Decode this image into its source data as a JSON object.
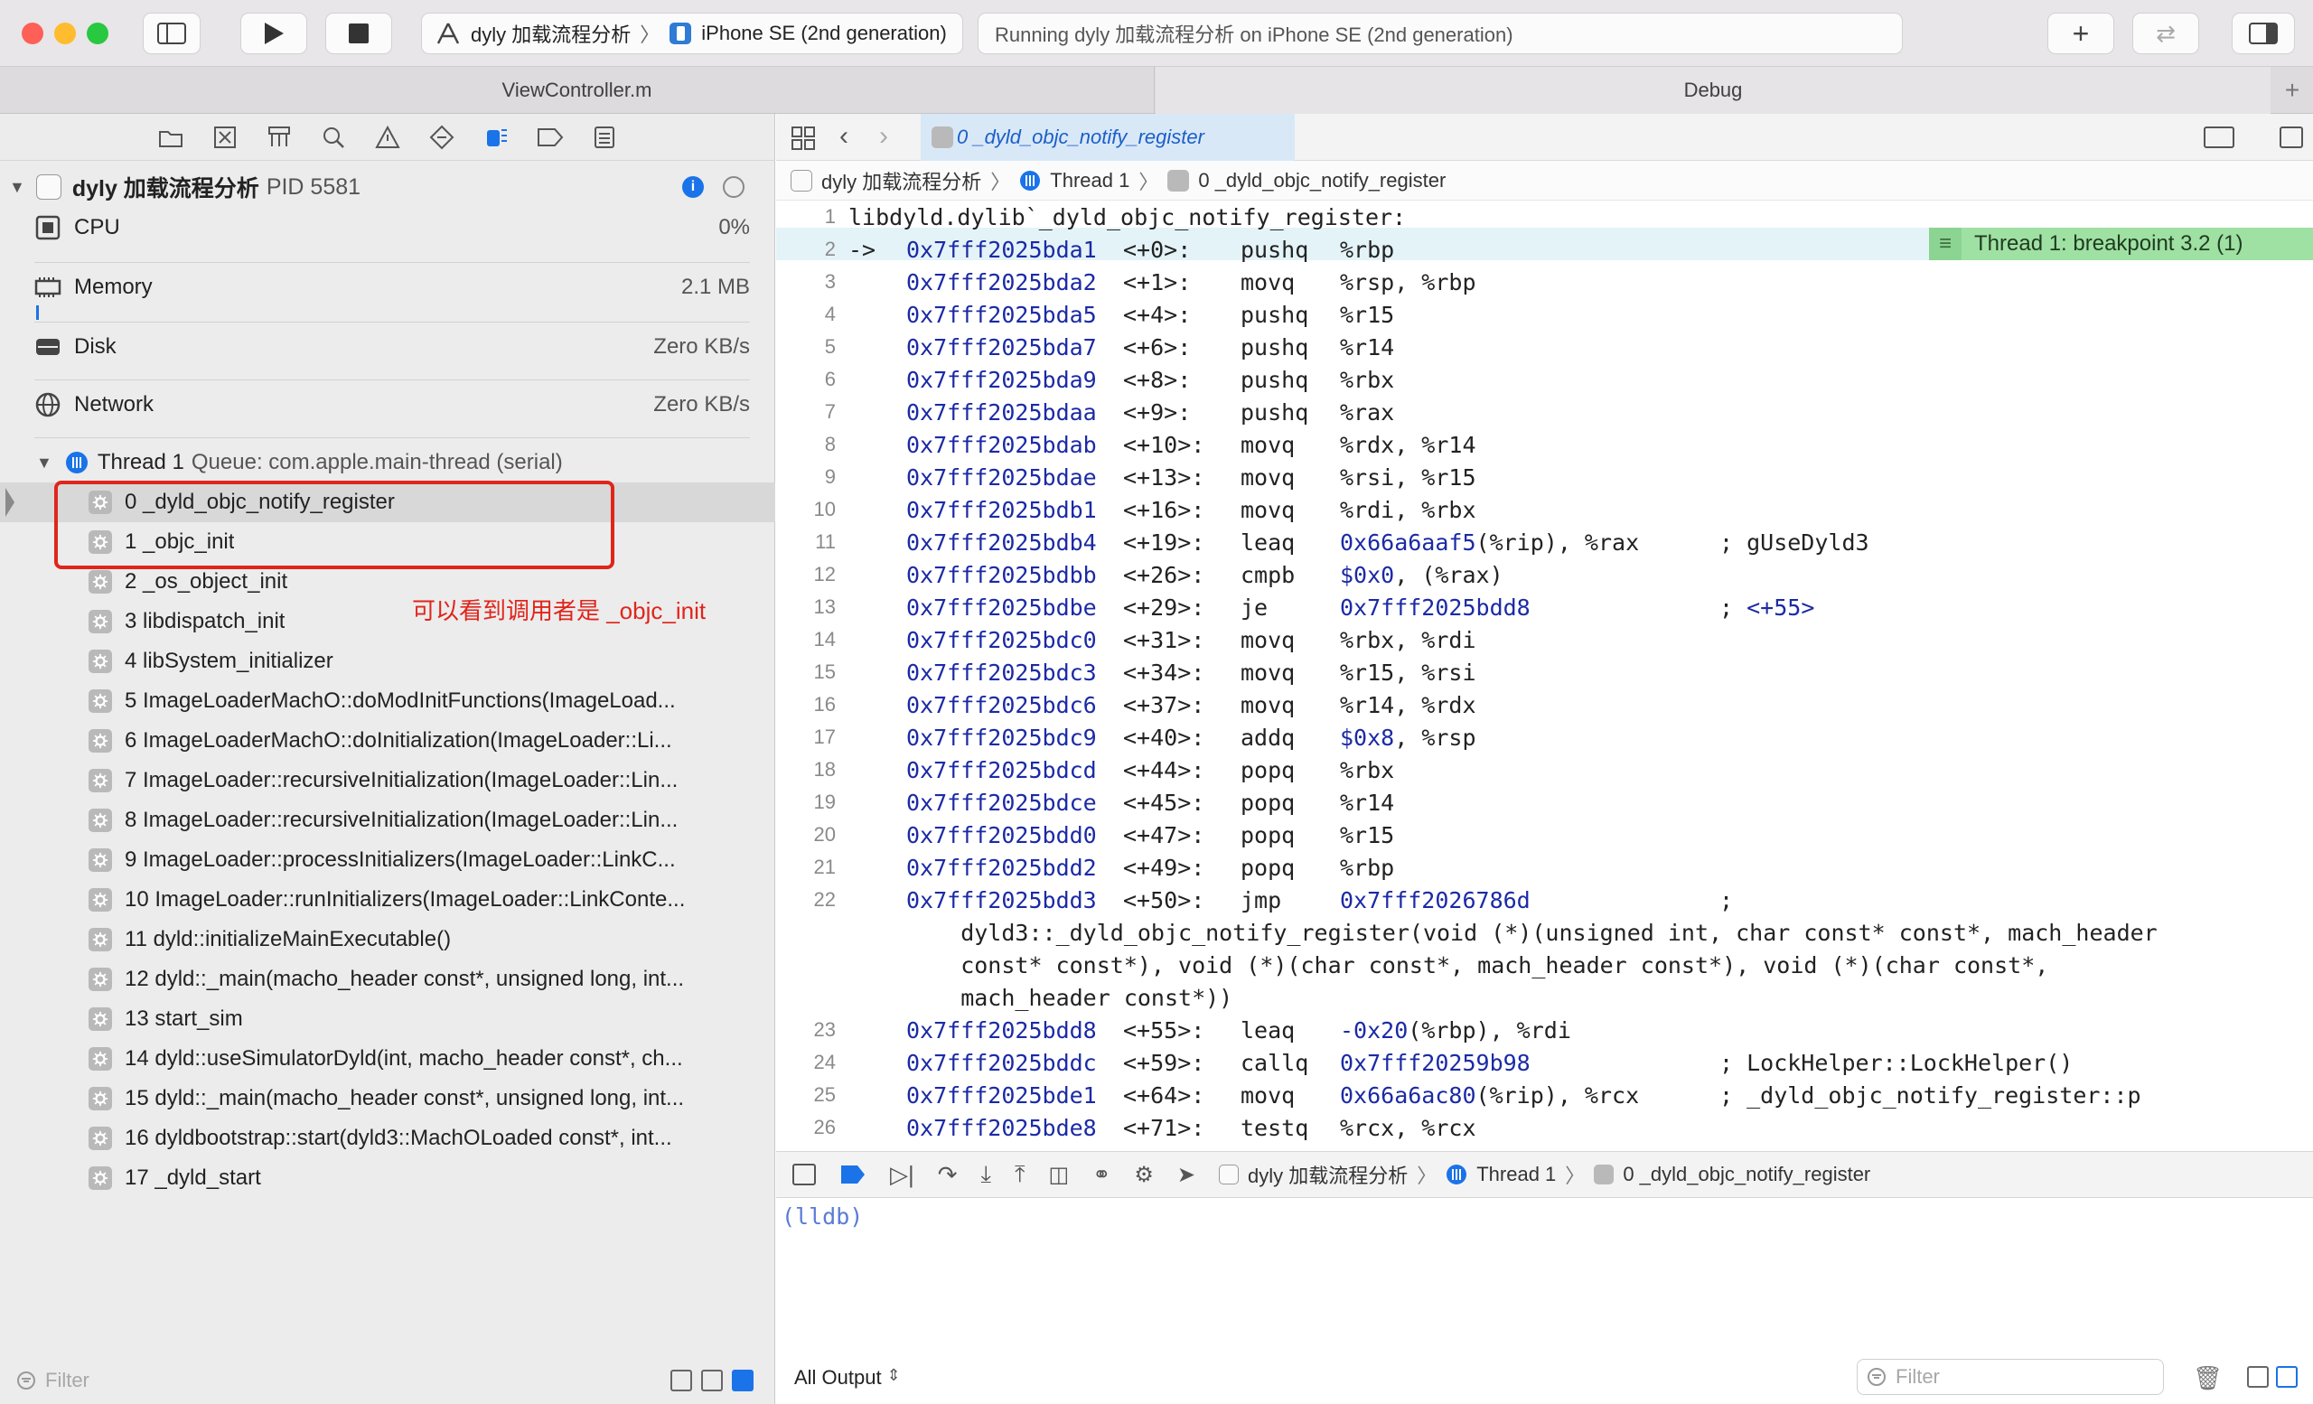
{
  "window": {
    "scheme": "dyly 加载流程分析",
    "device": "iPhone SE (2nd generation)",
    "status": "Running dyly 加载流程分析 on iPhone SE (2nd generation)"
  },
  "tabs": [
    "ViewController.m",
    "Debug"
  ],
  "navigator": {
    "process": {
      "name": "dyly 加载流程分析",
      "pid": "PID 5581"
    },
    "gauges": [
      {
        "label": "CPU",
        "value": "0%"
      },
      {
        "label": "Memory",
        "value": "2.1 MB"
      },
      {
        "label": "Disk",
        "value": "Zero KB/s"
      },
      {
        "label": "Network",
        "value": "Zero KB/s"
      }
    ],
    "thread": {
      "name": "Thread 1",
      "queue": "Queue: com.apple.main-thread (serial)"
    },
    "frames": [
      "0 _dyld_objc_notify_register",
      "1 _objc_init",
      "2 _os_object_init",
      "3 libdispatch_init",
      "4 libSystem_initializer",
      "5 ImageLoaderMachO::doModInitFunctions(ImageLoad...",
      "6 ImageLoaderMachO::doInitialization(ImageLoader::Li...",
      "7 ImageLoader::recursiveInitialization(ImageLoader::Lin...",
      "8 ImageLoader::recursiveInitialization(ImageLoader::Lin...",
      "9 ImageLoader::processInitializers(ImageLoader::LinkC...",
      "10 ImageLoader::runInitializers(ImageLoader::LinkConte...",
      "11 dyld::initializeMainExecutable()",
      "12 dyld::_main(macho_header const*, unsigned long, int...",
      "13 start_sim",
      "14 dyld::useSimulatorDyld(int, macho_header const*, ch...",
      "15 dyld::_main(macho_header const*, unsigned long, int...",
      "16 dyldbootstrap::start(dyld3::MachOLoaded const*, int...",
      "17 _dyld_start"
    ],
    "annotation": "可以看到调用者是 _objc_init",
    "filter_placeholder": "Filter"
  },
  "editor": {
    "tab_title": "0 _dyld_objc_notify_register",
    "crumbs": [
      "dyly 加载流程分析",
      "Thread 1",
      "0 _dyld_objc_notify_register"
    ],
    "breakpoint_label": "Thread 1: breakpoint 3.2 (1)",
    "lines": [
      {
        "n": "1",
        "a": "",
        "o": "",
        "m": "",
        "args": "libdyld.dylib`_dyld_objc_notify_register:",
        "c": ""
      },
      {
        "n": "2",
        "a": "0x7fff2025bda1",
        "o": "<+0>:",
        "m": "pushq",
        "args": "%rbp",
        "c": ""
      },
      {
        "n": "3",
        "a": "0x7fff2025bda2",
        "o": "<+1>:",
        "m": "movq",
        "args": "%rsp, %rbp",
        "c": ""
      },
      {
        "n": "4",
        "a": "0x7fff2025bda5",
        "o": "<+4>:",
        "m": "pushq",
        "args": "%r15",
        "c": ""
      },
      {
        "n": "5",
        "a": "0x7fff2025bda7",
        "o": "<+6>:",
        "m": "pushq",
        "args": "%r14",
        "c": ""
      },
      {
        "n": "6",
        "a": "0x7fff2025bda9",
        "o": "<+8>:",
        "m": "pushq",
        "args": "%rbx",
        "c": ""
      },
      {
        "n": "7",
        "a": "0x7fff2025bdaa",
        "o": "<+9>:",
        "m": "pushq",
        "args": "%rax",
        "c": ""
      },
      {
        "n": "8",
        "a": "0x7fff2025bdab",
        "o": "<+10>:",
        "m": "movq",
        "args": "%rdx, %r14",
        "c": ""
      },
      {
        "n": "9",
        "a": "0x7fff2025bdae",
        "o": "<+13>:",
        "m": "movq",
        "args": "%rsi, %r15",
        "c": ""
      },
      {
        "n": "10",
        "a": "0x7fff2025bdb1",
        "o": "<+16>:",
        "m": "movq",
        "args": "%rdi, %rbx",
        "c": ""
      },
      {
        "n": "11",
        "a": "0x7fff2025bdb4",
        "o": "<+19>:",
        "m": "leaq",
        "args": "0x66a6aaf5(%rip), %rax",
        "c": "; gUseDyld3"
      },
      {
        "n": "12",
        "a": "0x7fff2025bdbb",
        "o": "<+26>:",
        "m": "cmpb",
        "args": "$0x0, (%rax)",
        "c": ""
      },
      {
        "n": "13",
        "a": "0x7fff2025bdbe",
        "o": "<+29>:",
        "m": "je",
        "args": "0x7fff2025bdd8",
        "c": "; <+55>"
      },
      {
        "n": "14",
        "a": "0x7fff2025bdc0",
        "o": "<+31>:",
        "m": "movq",
        "args": "%rbx, %rdi",
        "c": ""
      },
      {
        "n": "15",
        "a": "0x7fff2025bdc3",
        "o": "<+34>:",
        "m": "movq",
        "args": "%r15, %rsi",
        "c": ""
      },
      {
        "n": "16",
        "a": "0x7fff2025bdc6",
        "o": "<+37>:",
        "m": "movq",
        "args": "%r14, %rdx",
        "c": ""
      },
      {
        "n": "17",
        "a": "0x7fff2025bdc9",
        "o": "<+40>:",
        "m": "addq",
        "args": "$0x8, %rsp",
        "c": ""
      },
      {
        "n": "18",
        "a": "0x7fff2025bdcd",
        "o": "<+44>:",
        "m": "popq",
        "args": "%rbx",
        "c": ""
      },
      {
        "n": "19",
        "a": "0x7fff2025bdce",
        "o": "<+45>:",
        "m": "popq",
        "args": "%r14",
        "c": ""
      },
      {
        "n": "20",
        "a": "0x7fff2025bdd0",
        "o": "<+47>:",
        "m": "popq",
        "args": "%r15",
        "c": ""
      },
      {
        "n": "21",
        "a": "0x7fff2025bdd2",
        "o": "<+49>:",
        "m": "popq",
        "args": "%rbp",
        "c": ""
      },
      {
        "n": "22",
        "a": "0x7fff2025bdd3",
        "o": "<+50>:",
        "m": "jmp",
        "args": "0x7fff2026786d",
        "c": ";"
      },
      {
        "n": "",
        "a": "",
        "o": "",
        "m": "",
        "args": "    dyld3::_dyld_objc_notify_register(void (*)(unsigned int, char const* const*, mach_header",
        "c": ""
      },
      {
        "n": "",
        "a": "",
        "o": "",
        "m": "",
        "args": "    const* const*), void (*)(char const*, mach_header const*), void (*)(char const*,",
        "c": ""
      },
      {
        "n": "",
        "a": "",
        "o": "",
        "m": "",
        "args": "    mach_header const*))",
        "c": ""
      },
      {
        "n": "23",
        "a": "0x7fff2025bdd8",
        "o": "<+55>:",
        "m": "leaq",
        "args": "-0x20(%rbp), %rdi",
        "c": ""
      },
      {
        "n": "24",
        "a": "0x7fff2025bddc",
        "o": "<+59>:",
        "m": "callq",
        "args": "0x7fff20259b98",
        "c": "; LockHelper::LockHelper()"
      },
      {
        "n": "25",
        "a": "0x7fff2025bde1",
        "o": "<+64>:",
        "m": "movq",
        "args": "0x66a6ac80(%rip), %rcx",
        "c": "; _dyld_objc_notify_register::p"
      },
      {
        "n": "26",
        "a": "0x7fff2025bde8",
        "o": "<+71>:",
        "m": "testq",
        "args": "%rcx, %rcx",
        "c": ""
      }
    ]
  },
  "debugbar": {
    "crumbs": [
      "dyly 加载流程分析",
      "Thread 1",
      "0 _dyld_objc_notify_register"
    ]
  },
  "console": {
    "prompt": "(lldb)",
    "output_mode": "All Output",
    "filter_placeholder": "Filter"
  },
  "colors": {
    "accent": "#1a73e8",
    "breakpoint": "#9fe0a3",
    "current_line": "#e4f3f8",
    "annotation_red": "#e0251b",
    "address_blue": "#1b2aa5"
  }
}
